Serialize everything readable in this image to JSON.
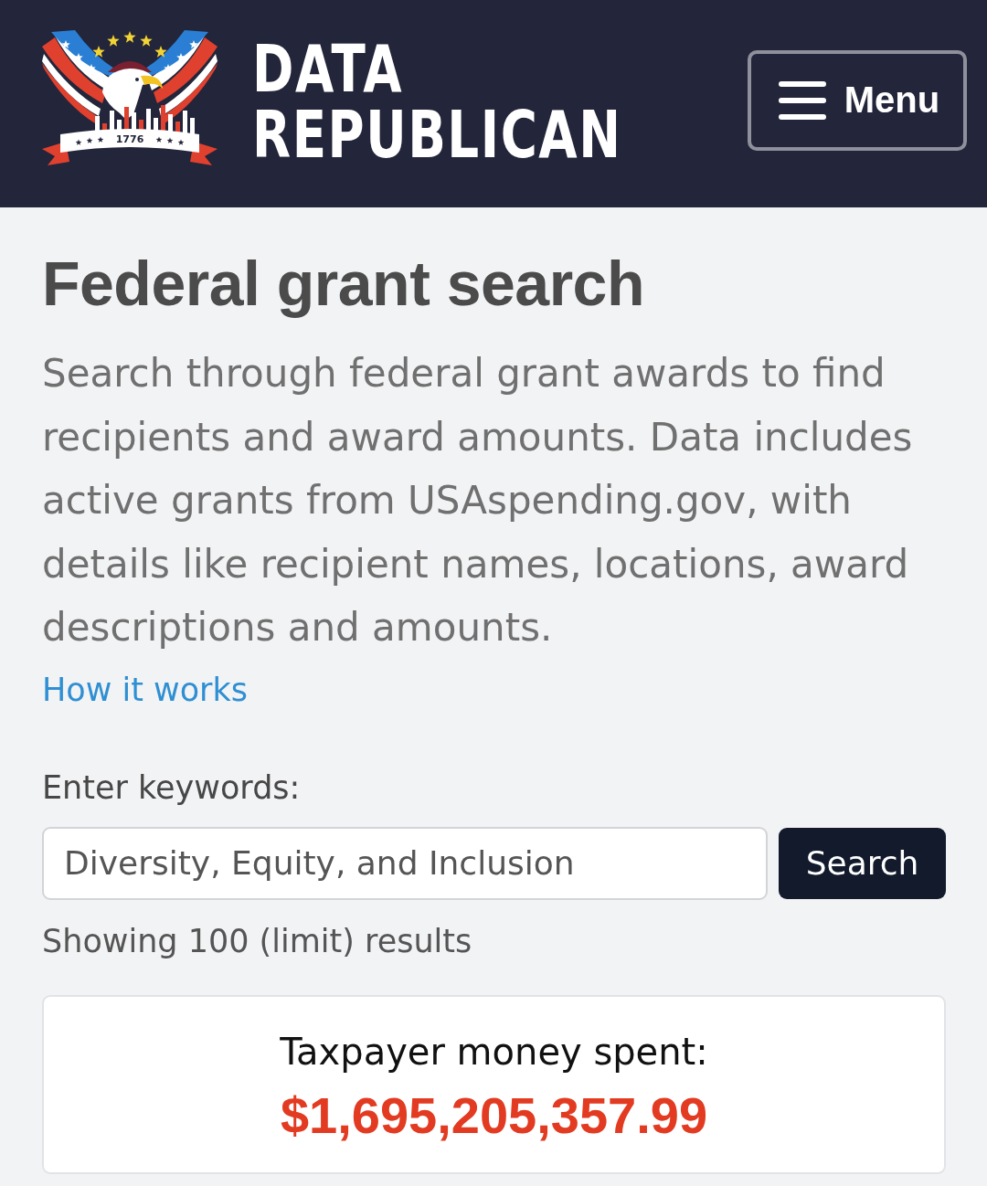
{
  "header": {
    "logo": {
      "banner_text": "1776"
    },
    "brand_lines": [
      "DATA",
      "REPUBLICAN"
    ],
    "menu_button": {
      "label": "Menu"
    }
  },
  "intro": {
    "title": "Federal grant search",
    "description": "Search through federal grant awards to find recipients and award amounts. Data includes active grants from USAspending.gov, with details like recipient names, locations, award descriptions and amounts.",
    "link": "How it works"
  },
  "search": {
    "label": "Enter keywords:",
    "value": "Diversity, Equity, and Inclusion",
    "button": "Search"
  },
  "results_note": "Showing 100 (limit) results",
  "summary_card": {
    "label": "Taxpayer money spent:",
    "amount": "$1,695,205,357.99"
  }
}
